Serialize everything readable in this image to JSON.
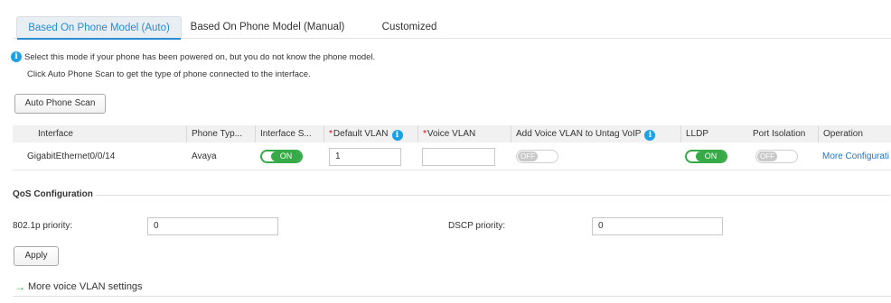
{
  "tabs": [
    {
      "label": "Based On Phone Model (Auto)",
      "active": true
    },
    {
      "label": "Based On Phone Model (Manual)",
      "active": false
    },
    {
      "label": "Customized",
      "active": false
    }
  ],
  "info": {
    "line1": "Select this mode if your phone has been powered on, but you do not know the phone model.",
    "line2": "Click Auto Phone Scan to get the type of phone connected to the interface."
  },
  "scan_button": "Auto Phone Scan",
  "table": {
    "headers": {
      "interface": "Interface",
      "phone_type": "Phone Typ...",
      "interface_status": "Interface S...",
      "default_vlan_req": "*",
      "default_vlan": "Default VLAN",
      "voice_vlan_req": "*",
      "voice_vlan": "Voice VLAN",
      "add_voice_vlan": "Add Voice VLAN to Untag VoIP",
      "lldp": "LLDP",
      "port_isolation": "Port Isolation",
      "operation": "Operation"
    },
    "row": {
      "interface": "GigabitEthernet0/0/14",
      "phone_type": "Avaya",
      "interface_status": "ON",
      "default_vlan": "1",
      "voice_vlan": "",
      "add_voice_vlan": "OFF",
      "lldp": "ON",
      "port_isolation": "OFF",
      "operation": "More Configurati"
    }
  },
  "qos": {
    "title": "QoS Configuration",
    "dot1p_label": "802.1p priority:",
    "dot1p_value": "0",
    "dscp_label": "DSCP priority:",
    "dscp_value": "0"
  },
  "apply_button": "Apply",
  "more_settings": "More voice VLAN settings",
  "colors": {
    "accent": "#2a8bd1",
    "toggle_on": "#35aa47",
    "toggle_off": "#c9c9c9",
    "info_icon": "#1aa1e6",
    "required": "#e60012",
    "link": "#1874cd"
  }
}
